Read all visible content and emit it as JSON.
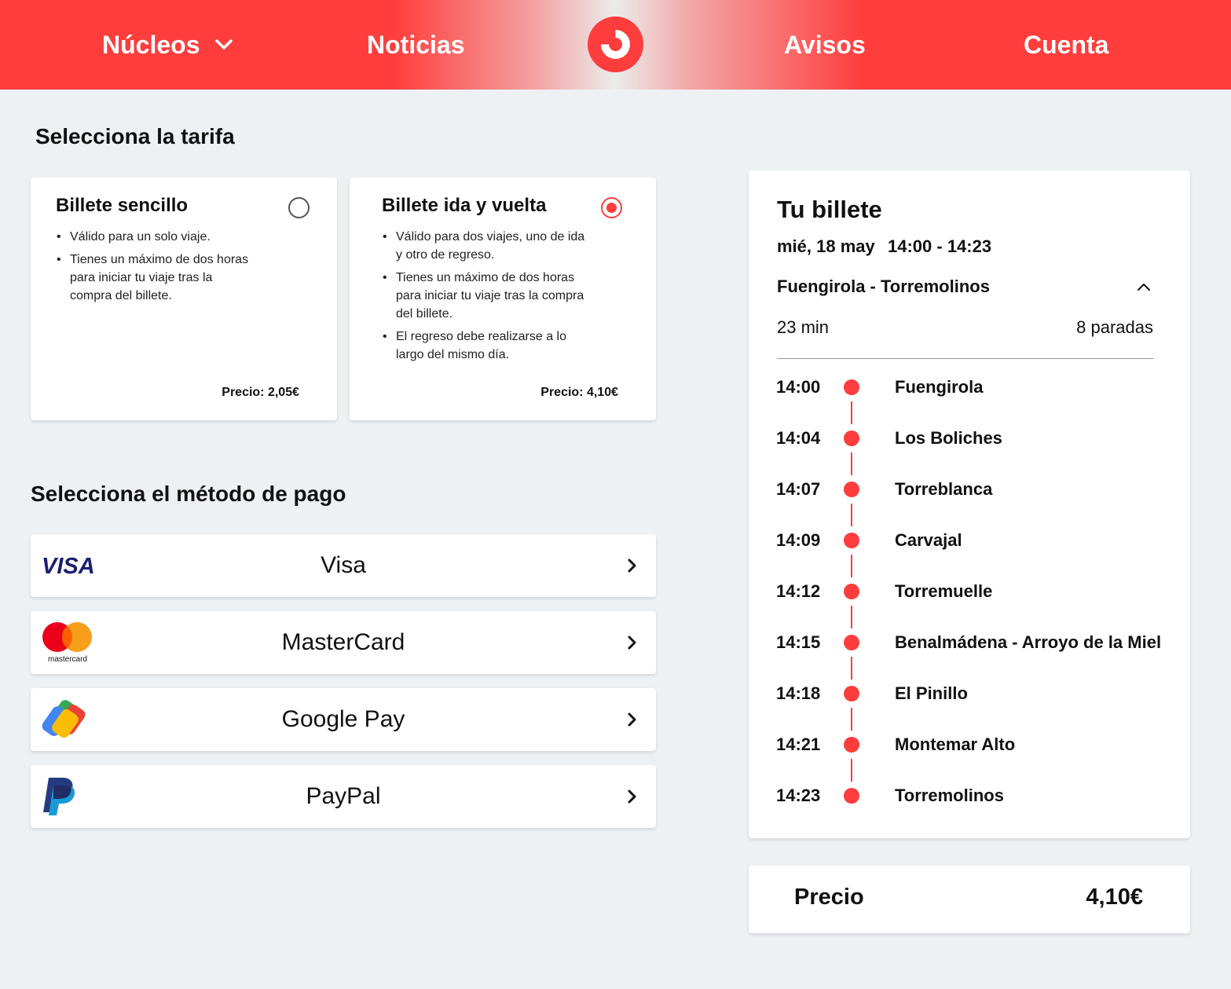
{
  "nav": {
    "nucleos": "Núcleos",
    "noticias": "Noticias",
    "avisos": "Avisos",
    "cuenta": "Cuenta",
    "brand_color": "#ff3d3d"
  },
  "tarifa": {
    "heading": "Selecciona la tarifa",
    "options": [
      {
        "title": "Billete sencillo",
        "selected": false,
        "bullets": [
          "Válido para un solo viaje.",
          "Tienes un máximo de dos horas para iniciar tu viaje tras la compra del billete."
        ],
        "price": "Precio: 2,05€"
      },
      {
        "title": "Billete ida y vuelta",
        "selected": true,
        "bullets": [
          "Válido para dos viajes, uno de ida y otro de regreso.",
          "Tienes un máximo de dos horas para iniciar tu viaje tras la compra del billete.",
          "El regreso debe realizarse a lo largo del mismo día."
        ],
        "price": "Precio: 4,10€"
      }
    ]
  },
  "pago": {
    "heading": "Selecciona el método de pago",
    "methods": [
      {
        "label": "Visa",
        "icon": "visa-icon",
        "logo_text": "VISA"
      },
      {
        "label": "MasterCard",
        "icon": "mastercard-icon",
        "logo_text": "mastercard"
      },
      {
        "label": "Google Pay",
        "icon": "google-pay-icon"
      },
      {
        "label": "PayPal",
        "icon": "paypal-icon"
      }
    ]
  },
  "ticket": {
    "title": "Tu billete",
    "date": "mié, 18 may",
    "time": "14:00 - 14:23",
    "route": "Fuengirola - Torremolinos",
    "duration": "23 min",
    "stops_count": "8 paradas",
    "stops": [
      {
        "time": "14:00",
        "name": "Fuengirola"
      },
      {
        "time": "14:04",
        "name": "Los Boliches"
      },
      {
        "time": "14:07",
        "name": "Torreblanca"
      },
      {
        "time": "14:09",
        "name": "Carvajal"
      },
      {
        "time": "14:12",
        "name": "Torremuelle"
      },
      {
        "time": "14:15",
        "name": "Benalmádena - Arroyo de la Miel"
      },
      {
        "time": "14:18",
        "name": "El Pinillo"
      },
      {
        "time": "14:21",
        "name": "Montemar Alto"
      },
      {
        "time": "14:23",
        "name": "Torremolinos"
      }
    ]
  },
  "price": {
    "label": "Precio",
    "value": "4,10€"
  }
}
